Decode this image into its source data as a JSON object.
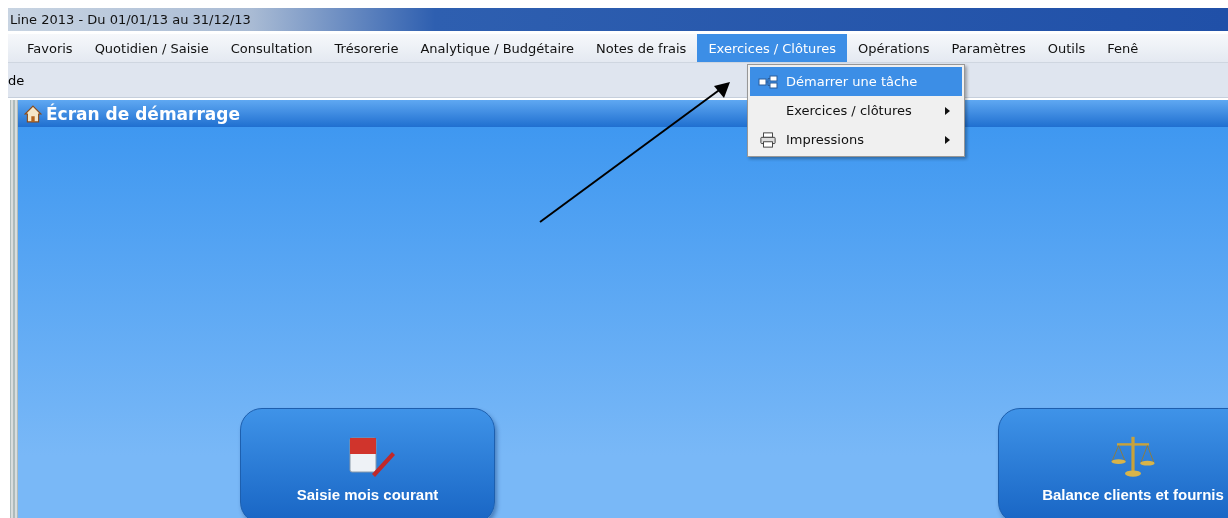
{
  "window": {
    "title": "Line 2013 - Du 01/01/13 au 31/12/13"
  },
  "menu_bar": [
    {
      "label": "Favoris",
      "selected": false
    },
    {
      "label": "Quotidien / Saisie",
      "selected": false
    },
    {
      "label": "Consultation",
      "selected": false
    },
    {
      "label": "Trésorerie",
      "selected": false
    },
    {
      "label": "Analytique / Budgétaire",
      "selected": false
    },
    {
      "label": "Notes de frais",
      "selected": false
    },
    {
      "label": "Exercices / Clôtures",
      "selected": true
    },
    {
      "label": "Opérations",
      "selected": false
    },
    {
      "label": "Paramètres",
      "selected": false
    },
    {
      "label": "Outils",
      "selected": false
    },
    {
      "label": "Fenê",
      "selected": false
    }
  ],
  "dropdown": [
    {
      "label": "Démarrer une tâche",
      "kind": "task",
      "selected": true,
      "submenu": false
    },
    {
      "label": "Exercices / clôtures",
      "selected": false,
      "submenu": true
    },
    {
      "label": "Impressions",
      "kind": "printer",
      "selected": false,
      "submenu": true
    }
  ],
  "toolbar": {
    "text": "de"
  },
  "panel": {
    "title": "Écran de démarrage"
  },
  "tiles": [
    {
      "label": "Saisie mois courant",
      "kind": "calendar"
    },
    {
      "label": "Balance clients et fournis",
      "kind": "scales"
    }
  ]
}
